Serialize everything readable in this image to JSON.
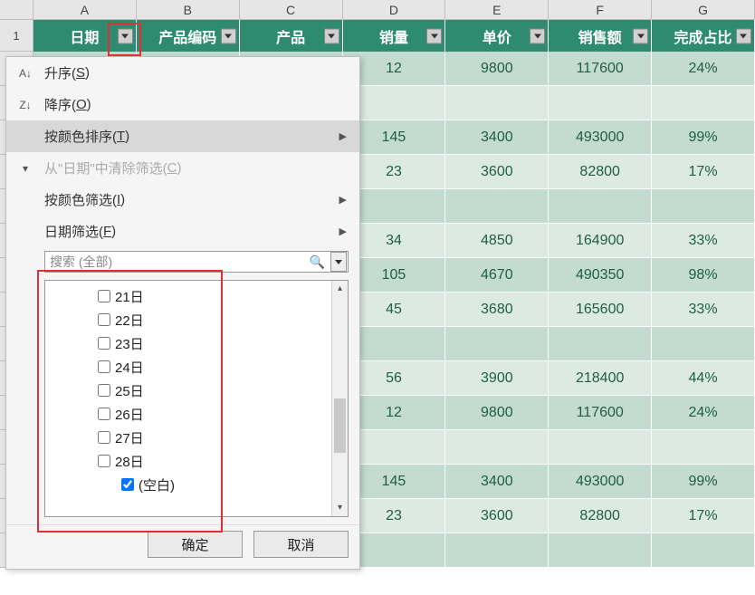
{
  "columns": [
    "A",
    "B",
    "C",
    "D",
    "E",
    "F",
    "G"
  ],
  "row_label": "1",
  "headers": [
    "日期",
    "产品编码",
    "产品",
    "销量",
    "单价",
    "销售额",
    "完成占比"
  ],
  "rows": [
    {
      "d": "12",
      "e": "9800",
      "f": "117600",
      "g": "24%"
    },
    {
      "d": "",
      "e": "",
      "f": "",
      "g": ""
    },
    {
      "d": "145",
      "e": "3400",
      "f": "493000",
      "g": "99%"
    },
    {
      "d": "23",
      "e": "3600",
      "f": "82800",
      "g": "17%"
    },
    {
      "d": "",
      "e": "",
      "f": "",
      "g": ""
    },
    {
      "d": "34",
      "e": "4850",
      "f": "164900",
      "g": "33%"
    },
    {
      "d": "105",
      "e": "4670",
      "f": "490350",
      "g": "98%"
    },
    {
      "d": "45",
      "e": "3680",
      "f": "165600",
      "g": "33%"
    },
    {
      "d": "",
      "e": "",
      "f": "",
      "g": ""
    },
    {
      "d": "56",
      "e": "3900",
      "f": "218400",
      "g": "44%"
    },
    {
      "d": "12",
      "e": "9800",
      "f": "117600",
      "g": "24%"
    },
    {
      "d": "",
      "e": "",
      "f": "",
      "g": ""
    },
    {
      "d": "145",
      "e": "3400",
      "f": "493000",
      "g": "99%"
    },
    {
      "d": "23",
      "e": "3600",
      "f": "82800",
      "g": "17%"
    },
    {
      "d": "",
      "e": "",
      "f": "",
      "g": ""
    }
  ],
  "menu": {
    "asc": "升序(",
    "asc_k": "S",
    "asc_e": ")",
    "desc": "降序(",
    "desc_k": "O",
    "desc_e": ")",
    "sort_color": "按颜色排序(",
    "sort_color_k": "T",
    "sort_color_e": ")",
    "clear": "从\"日期\"中清除筛选(",
    "clear_k": "C",
    "clear_e": ")",
    "filter_color": "按颜色筛选(",
    "filter_color_k": "I",
    "filter_color_e": ")",
    "date_filter": "日期筛选(",
    "date_filter_k": "F",
    "date_filter_e": ")"
  },
  "search": {
    "placeholder": "搜索 (全部)"
  },
  "tree": {
    "items": [
      "21日",
      "22日",
      "23日",
      "24日",
      "25日",
      "26日",
      "27日",
      "28日"
    ],
    "blank": "(空白)"
  },
  "buttons": {
    "ok": "确定",
    "cancel": "取消"
  },
  "chart_data": {
    "type": "table",
    "title": "",
    "headers": [
      "日期",
      "产品编码",
      "产品",
      "销量",
      "单价",
      "销售额",
      "完成占比"
    ],
    "visible_columns": [
      "销量",
      "单价",
      "销售额",
      "完成占比"
    ],
    "rows": [
      [
        12,
        9800,
        117600,
        "24%"
      ],
      [
        null,
        null,
        null,
        null
      ],
      [
        145,
        3400,
        493000,
        "99%"
      ],
      [
        23,
        3600,
        82800,
        "17%"
      ],
      [
        null,
        null,
        null,
        null
      ],
      [
        34,
        4850,
        164900,
        "33%"
      ],
      [
        105,
        4670,
        490350,
        "98%"
      ],
      [
        45,
        3680,
        165600,
        "33%"
      ],
      [
        null,
        null,
        null,
        null
      ],
      [
        56,
        3900,
        218400,
        "44%"
      ],
      [
        12,
        9800,
        117600,
        "24%"
      ],
      [
        null,
        null,
        null,
        null
      ],
      [
        145,
        3400,
        493000,
        "99%"
      ],
      [
        23,
        3600,
        82800,
        "17%"
      ],
      [
        null,
        null,
        null,
        null
      ]
    ]
  }
}
